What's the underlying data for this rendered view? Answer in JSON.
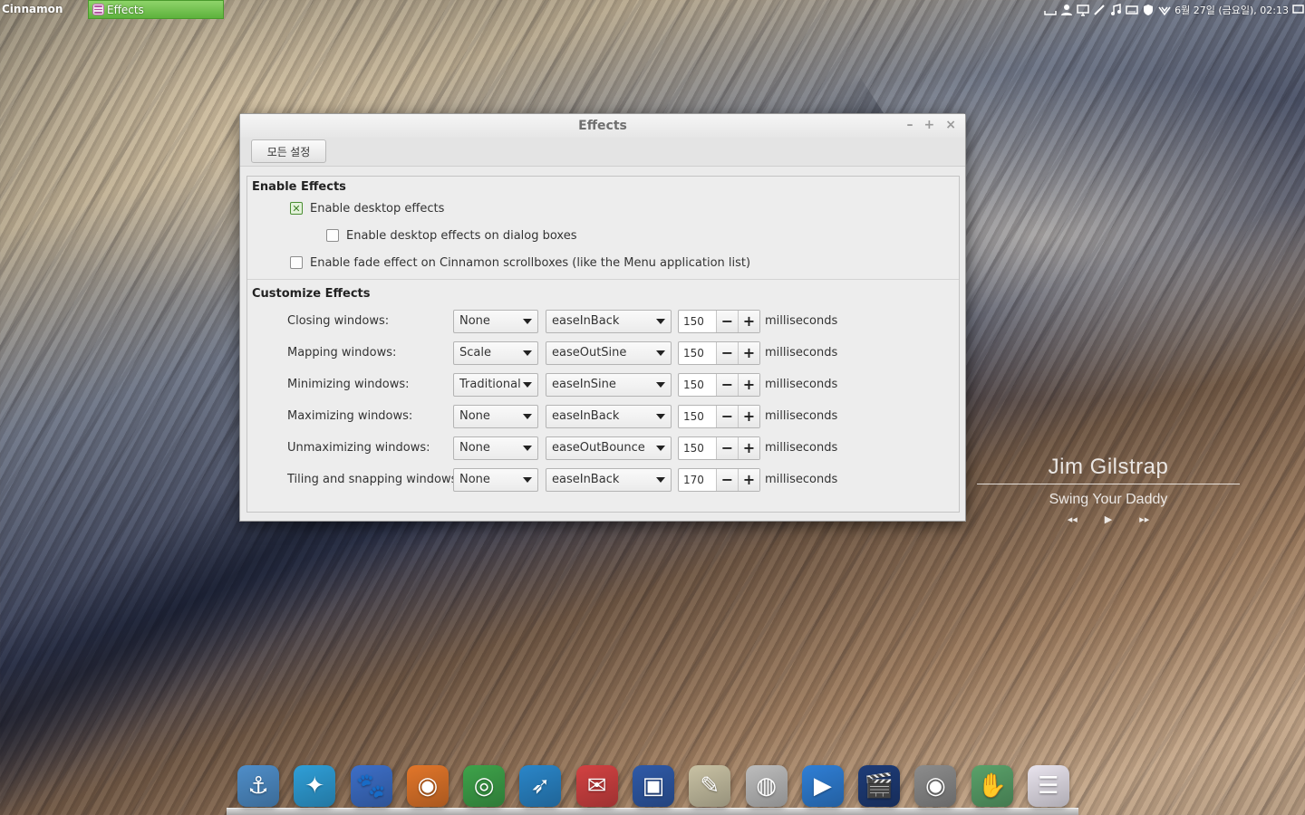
{
  "top_panel": {
    "menu_label": "Cinnamon",
    "taskbar_window": "Effects",
    "clock": "6월 27일 (금요일), 02:13"
  },
  "window": {
    "title": "Effects",
    "all_settings": "모든 설정",
    "buttons": {
      "minimize": "–",
      "maximize": "+",
      "close": "×"
    }
  },
  "enable_effects": {
    "title": "Enable Effects",
    "desktop_effects": {
      "label": "Enable desktop effects",
      "checked": true
    },
    "dialog_effects": {
      "label": "Enable desktop effects on dialog boxes",
      "checked": false
    },
    "fade_effect": {
      "label": "Enable fade effect on Cinnamon scrollboxes (like the Menu application list)",
      "checked": false
    }
  },
  "customize_effects": {
    "title": "Customize Effects",
    "unit": "milliseconds",
    "rows": [
      {
        "label": "Closing windows:",
        "style": "None",
        "easing": "easeInBack",
        "duration": "150"
      },
      {
        "label": "Mapping windows:",
        "style": "Scale",
        "easing": "easeOutSine",
        "duration": "150"
      },
      {
        "label": "Minimizing windows:",
        "style": "Traditional",
        "easing": "easeInSine",
        "duration": "150"
      },
      {
        "label": "Maximizing windows:",
        "style": "None",
        "easing": "easeInBack",
        "duration": "150"
      },
      {
        "label": "Unmaximizing windows:",
        "style": "None",
        "easing": "easeOutBounce",
        "duration": "150"
      },
      {
        "label": "Tiling and snapping windows:",
        "style": "None",
        "easing": "easeInBack",
        "duration": "170"
      }
    ]
  },
  "music": {
    "artist": "Jim Gilstrap",
    "song": "Swing Your Daddy"
  },
  "dock": [
    {
      "name": "anchor-icon",
      "glyph": "⚓",
      "color": "#4f8ec9"
    },
    {
      "name": "spark-icon",
      "glyph": "✦",
      "color": "#2f9fd8"
    },
    {
      "name": "paw-icon",
      "glyph": "🐾",
      "color": "#3d6fc8"
    },
    {
      "name": "firefox-icon",
      "glyph": "◉",
      "color": "#e2762a"
    },
    {
      "name": "chrome-icon",
      "glyph": "◎",
      "color": "#3ea34a"
    },
    {
      "name": "bird-icon",
      "glyph": "➶",
      "color": "#2a86c9"
    },
    {
      "name": "mail-icon",
      "glyph": "✉",
      "color": "#d34242"
    },
    {
      "name": "monitor-icon",
      "glyph": "▣",
      "color": "#2f5aa8"
    },
    {
      "name": "notepad-icon",
      "glyph": "✎",
      "color": "#c9c2a4"
    },
    {
      "name": "ipod-icon",
      "glyph": "◍",
      "color": "#bdbdbd"
    },
    {
      "name": "play-icon",
      "glyph": "▶",
      "color": "#2f7fd6"
    },
    {
      "name": "clapper-icon",
      "glyph": "🎬",
      "color": "#1e3c78"
    },
    {
      "name": "webcam-icon",
      "glyph": "◉",
      "color": "#8c8c8c"
    },
    {
      "name": "hand-icon",
      "glyph": "✋",
      "color": "#5aa26a"
    },
    {
      "name": "toggle-settings-icon",
      "glyph": "☰",
      "color": "#e9e4ee"
    }
  ]
}
